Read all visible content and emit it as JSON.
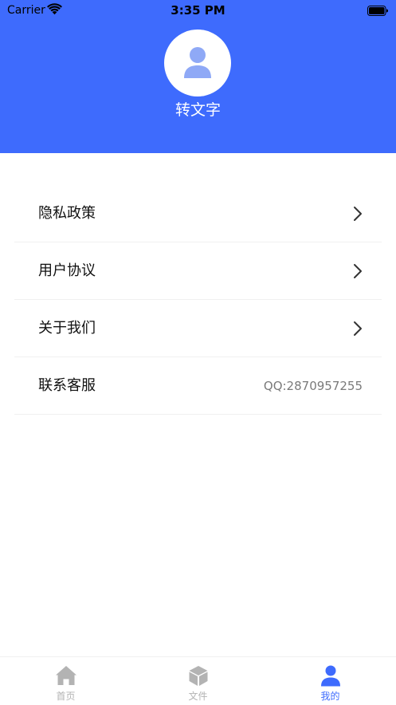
{
  "status_bar": {
    "carrier": "Carrier",
    "time": "3:35 PM"
  },
  "header": {
    "app_name": "转文字",
    "background_color": "#3e6bfd",
    "avatar_icon": "user-icon"
  },
  "menu": {
    "items": [
      {
        "label": "隐私政策",
        "icon": "chevron-right-icon"
      },
      {
        "label": "用户协议",
        "icon": "chevron-right-icon"
      },
      {
        "label": "关于我们",
        "icon": "chevron-right-icon"
      },
      {
        "label": "联系客服",
        "value": "QQ:2870957255"
      }
    ]
  },
  "tabbar": {
    "active_color": "#3e6bfd",
    "inactive_color": "#b3b3b3",
    "tabs": [
      {
        "label": "首页",
        "icon": "home-icon",
        "active": false
      },
      {
        "label": "文件",
        "icon": "cube-icon",
        "active": false
      },
      {
        "label": "我的",
        "icon": "user-icon",
        "active": true
      }
    ]
  }
}
